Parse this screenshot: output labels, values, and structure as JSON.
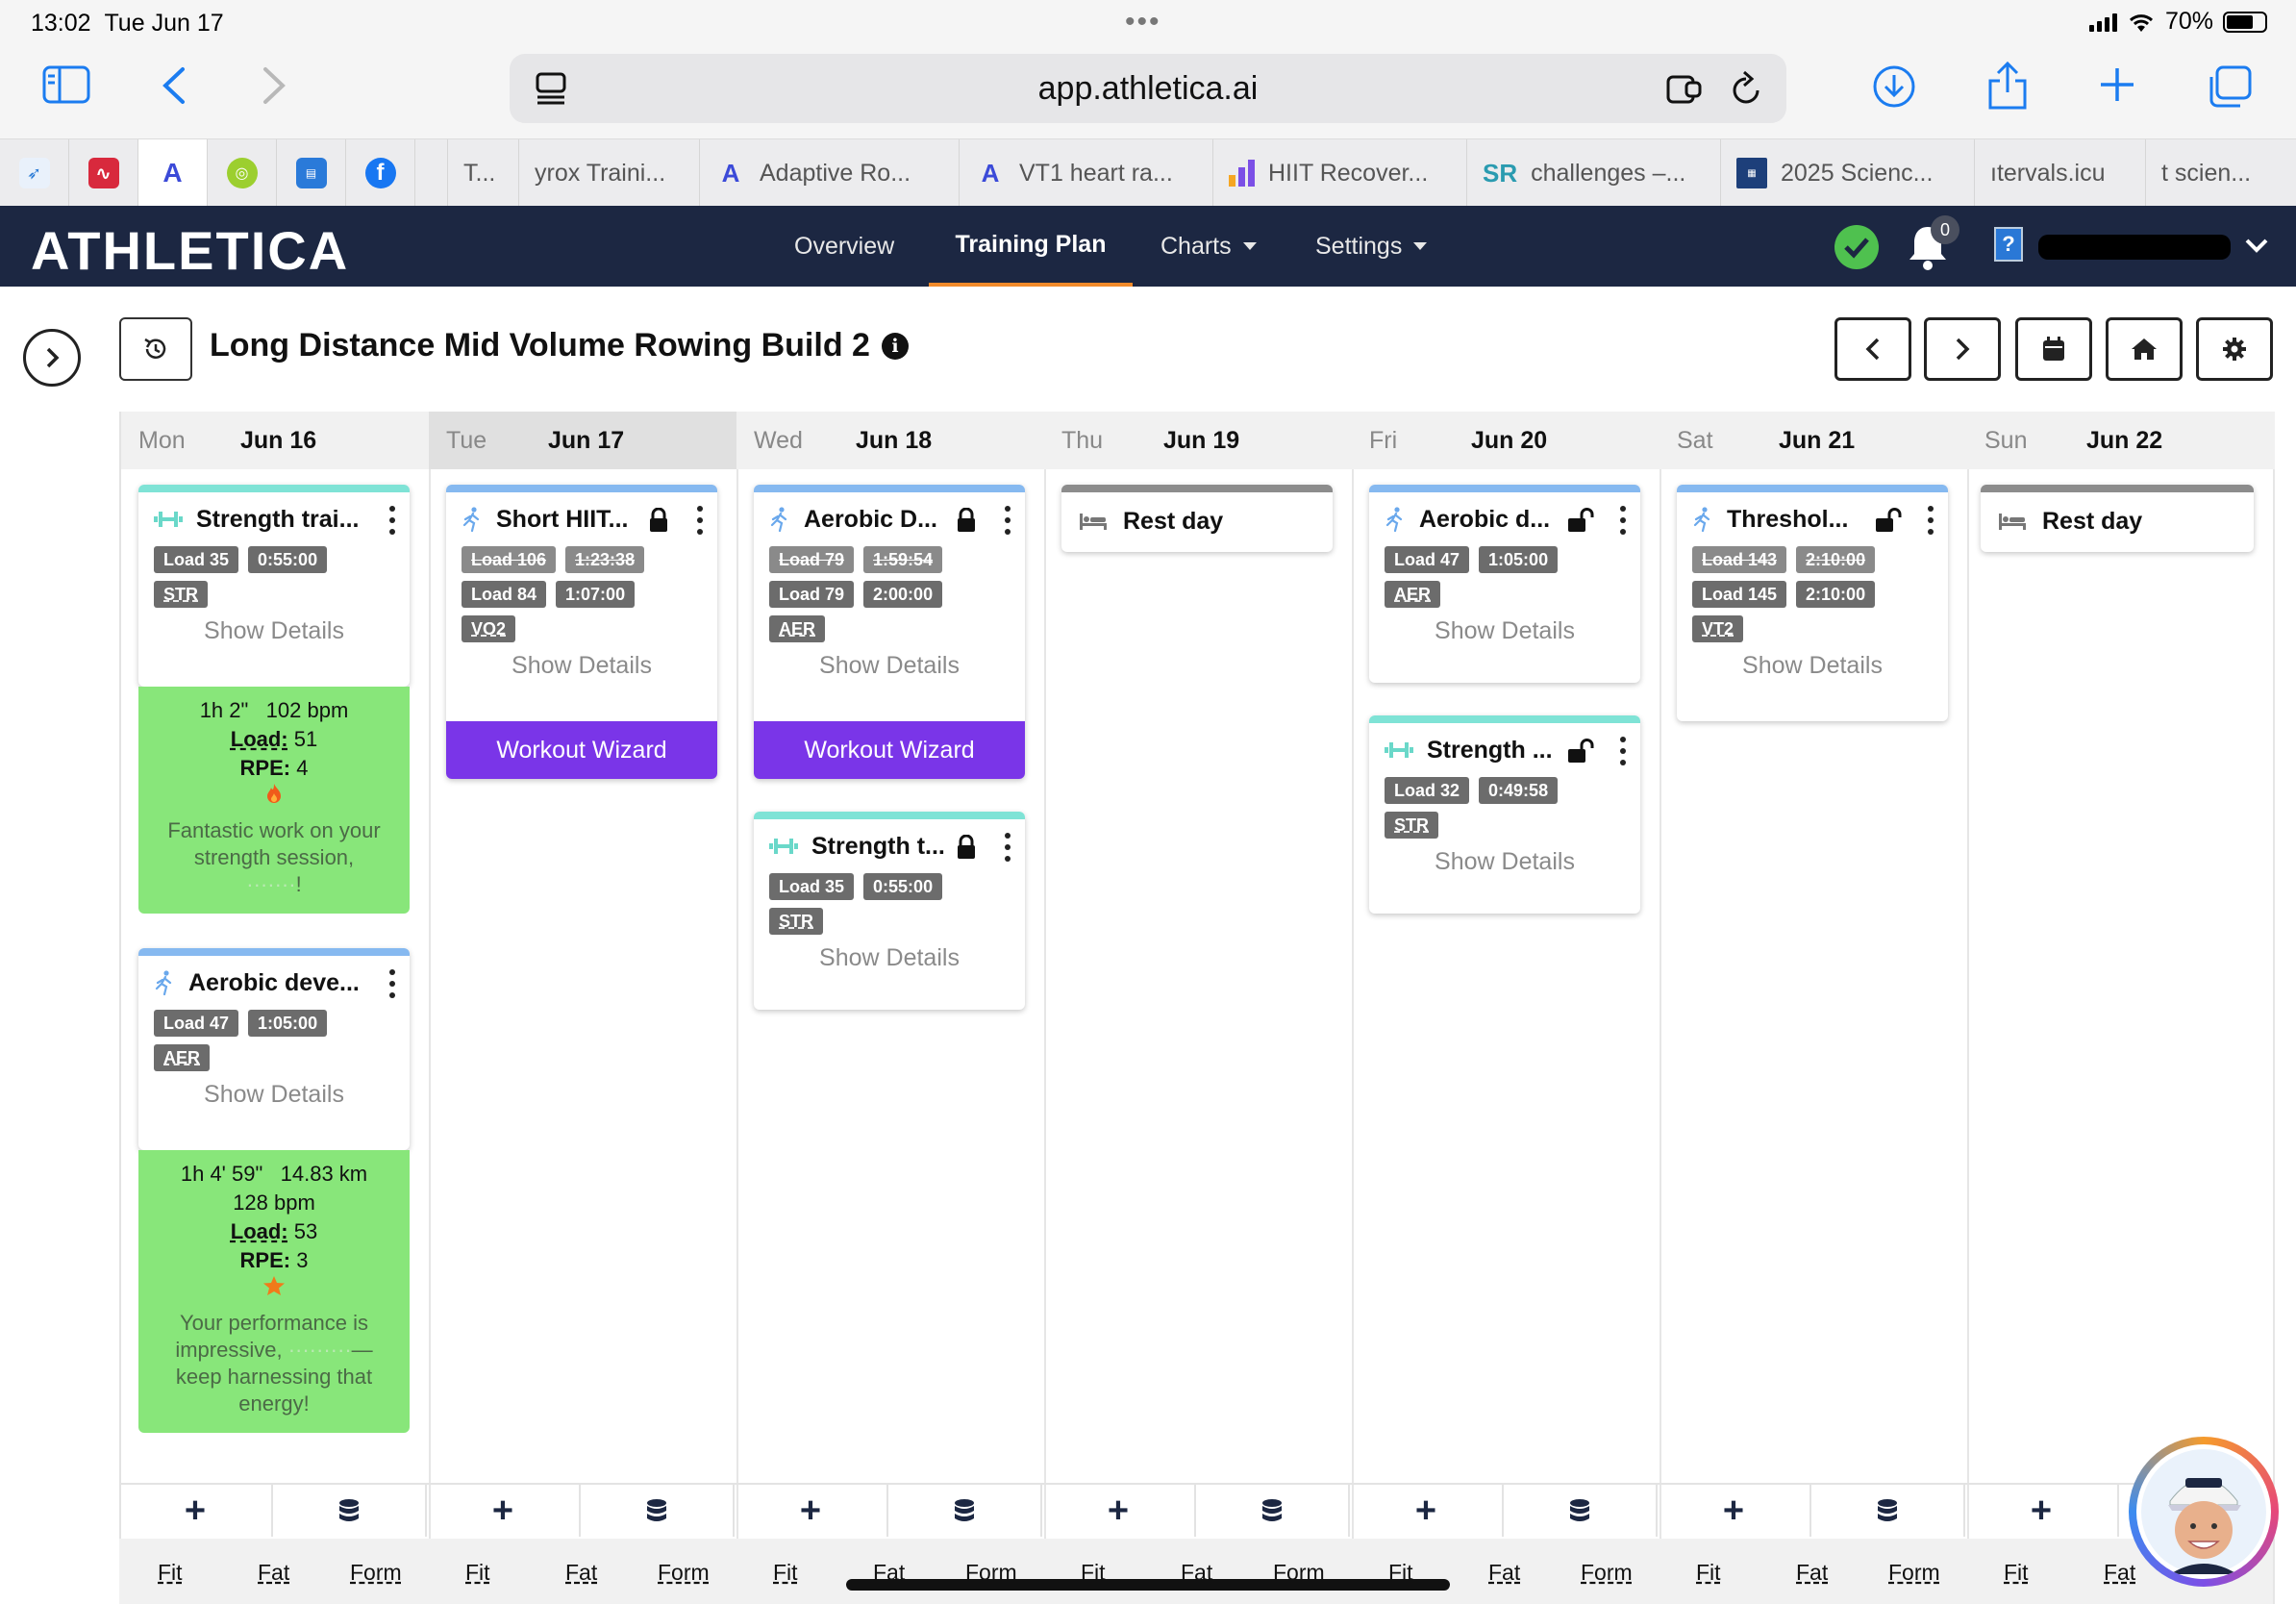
{
  "status": {
    "time": "13:02",
    "date": "Tue Jun 17",
    "battery": "70%"
  },
  "browser": {
    "url": "app.athletica.ai"
  },
  "tabs": [
    {
      "label": "T...",
      "color": "#555"
    },
    {
      "label": "yrox Traini...",
      "color": "#555"
    },
    {
      "label": "Adaptive Ro...",
      "color": "#555"
    },
    {
      "label": "VT1 heart ra...",
      "color": "#555"
    },
    {
      "label": "HIIT Recover...",
      "color": "#555"
    },
    {
      "label": "challenges –...",
      "color": "#555"
    },
    {
      "label": "2025 Scienc...",
      "color": "#555"
    },
    {
      "label": "ıtervals.icu",
      "color": "#555"
    },
    {
      "label": "t scien...",
      "color": "#555"
    }
  ],
  "app": {
    "brand": "ATHLETICA",
    "nav": {
      "overview": "Overview",
      "training_plan": "Training Plan",
      "charts": "Charts",
      "settings": "Settings"
    },
    "notifications": "0",
    "help": "?"
  },
  "plan": {
    "title": "Long Distance Mid Volume Rowing Build 2"
  },
  "days": [
    {
      "dow": "Mon",
      "date": "Jun 16"
    },
    {
      "dow": "Tue",
      "date": "Jun 17"
    },
    {
      "dow": "Wed",
      "date": "Jun 18"
    },
    {
      "dow": "Thu",
      "date": "Jun 19"
    },
    {
      "dow": "Fri",
      "date": "Jun 20"
    },
    {
      "dow": "Sat",
      "date": "Jun 21"
    },
    {
      "dow": "Sun",
      "date": "Jun 22"
    }
  ],
  "workouts": {
    "mon_strength": {
      "title": "Strength trai...",
      "load": "Load 35",
      "dur": "0:55:00",
      "zone": "STR",
      "show": "Show Details"
    },
    "mon_strength_done": {
      "time": "1h 2\"",
      "hr": "102 bpm",
      "load_label": "Load:",
      "load": "51",
      "rpe_label": "RPE:",
      "rpe": "4",
      "msg1": "Fantastic work on your",
      "msg2": "strength session,",
      "msg3": "!"
    },
    "mon_aerobic": {
      "title": "Aerobic deve...",
      "load": "Load 47",
      "dur": "1:05:00",
      "zone": "AER",
      "show": "Show Details"
    },
    "mon_aerobic_done": {
      "time": "1h 4' 59\"",
      "dist": "14.83 km",
      "hr": "128 bpm",
      "load_label": "Load:",
      "load": "53",
      "rpe_label": "RPE:",
      "rpe": "3",
      "msg1": "Your performance is",
      "msg2": "impressive,",
      "msg3": "keep harnessing that",
      "msg4": "energy!"
    },
    "tue_hiit": {
      "title": "Short HIIT...",
      "old_load": "Load 106",
      "old_dur": "1:23:38",
      "load": "Load 84",
      "dur": "1:07:00",
      "zone": "VO2",
      "show": "Show Details",
      "wizard": "Workout Wizard"
    },
    "wed_aerobic": {
      "title": "Aerobic D...",
      "old_load": "Load 79",
      "old_dur": "1:59:54",
      "load": "Load 79",
      "dur": "2:00:00",
      "zone": "AER",
      "show": "Show Details",
      "wizard": "Workout Wizard"
    },
    "wed_strength": {
      "title": "Strength t...",
      "load": "Load 35",
      "dur": "0:55:00",
      "zone": "STR",
      "show": "Show Details"
    },
    "thu_rest": {
      "title": "Rest day"
    },
    "fri_aerobic": {
      "title": "Aerobic d...",
      "load": "Load 47",
      "dur": "1:05:00",
      "zone": "AER",
      "show": "Show Details"
    },
    "fri_strength": {
      "title": "Strength ...",
      "load": "Load 32",
      "dur": "0:49:58",
      "zone": "STR",
      "show": "Show Details"
    },
    "sat_threshold": {
      "title": "Threshol...",
      "old_load": "Load 143",
      "old_dur": "2:10:00",
      "load": "Load 145",
      "dur": "2:10:00",
      "zone": "VT2",
      "show": "Show Details"
    },
    "sun_rest": {
      "title": "Rest day"
    }
  },
  "footer": {
    "fit": "Fit",
    "fat": "Fat",
    "form": "Form",
    "add": "+"
  },
  "colors": {
    "strength_bar": "#7fe3d6",
    "aerobic_bar": "#86b9f0",
    "rest_bar": "#8c8c8c",
    "done_green": "#88e67a",
    "wizard_purple": "#7a35e8",
    "nav_bg": "#1c2742",
    "accent_orange": "#f28a2a"
  }
}
